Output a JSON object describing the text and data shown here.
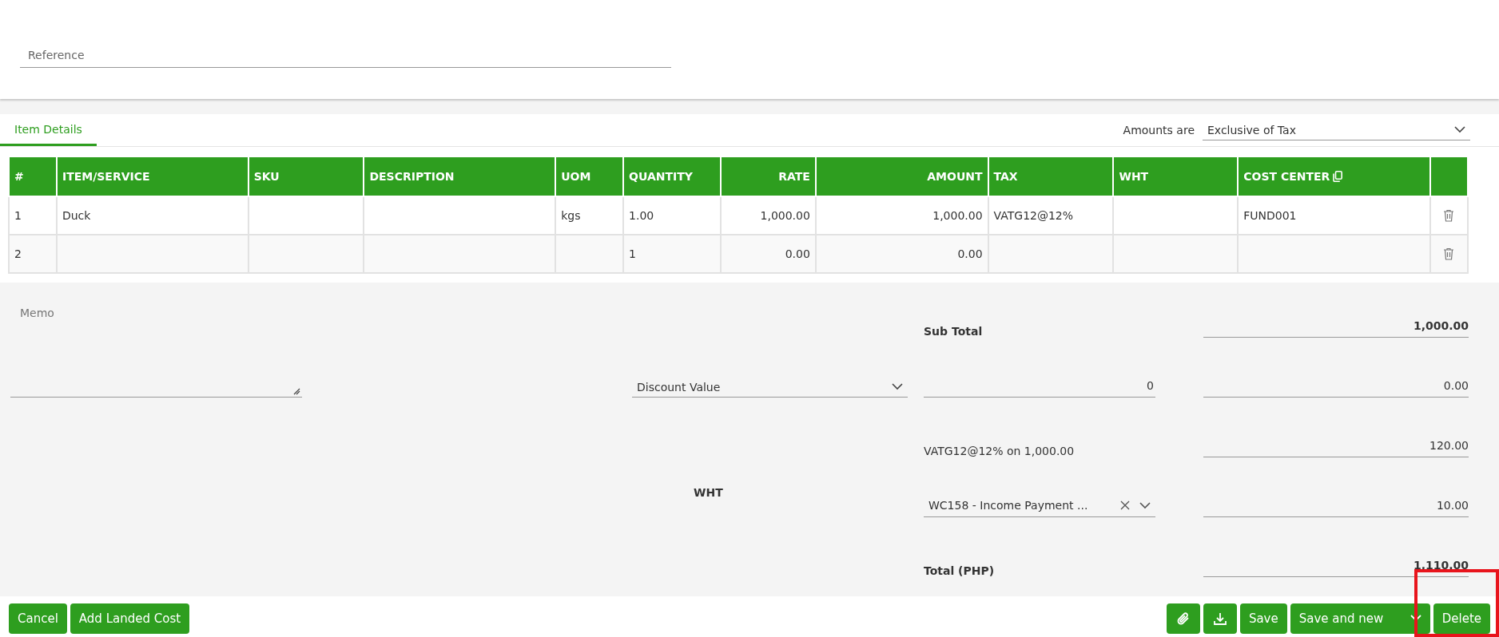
{
  "reference": {
    "placeholder": "Reference"
  },
  "tabs": [
    {
      "label": "Item Details",
      "selected": true
    }
  ],
  "amounts_are": {
    "label": "Amounts are",
    "value": "Exclusive of Tax"
  },
  "table": {
    "columns": [
      {
        "label": "#",
        "kind": "text"
      },
      {
        "label": "ITEM/SERVICE",
        "kind": "text"
      },
      {
        "label": "SKU",
        "kind": "text"
      },
      {
        "label": "DESCRIPTION",
        "kind": "text"
      },
      {
        "label": "UOM",
        "kind": "text"
      },
      {
        "label": "QUANTITY",
        "kind": "text"
      },
      {
        "label": "RATE",
        "kind": "number"
      },
      {
        "label": "AMOUNT",
        "kind": "number"
      },
      {
        "label": "TAX",
        "kind": "text"
      },
      {
        "label": "WHT",
        "kind": "text"
      },
      {
        "label": "COST CENTER",
        "kind": "copy"
      },
      {
        "kind": "delete"
      }
    ],
    "rows": [
      {
        "cells": [
          "1",
          "Duck",
          null,
          null,
          "kgs",
          "1.00",
          "1,000.00",
          "1,000.00",
          "VATG12@12%",
          null,
          "FUND001",
          null
        ]
      },
      {
        "cells": [
          "2",
          null,
          null,
          null,
          null,
          "1",
          "0.00",
          "0.00",
          null,
          null,
          null,
          null
        ]
      }
    ]
  },
  "memo": {
    "placeholder": "Memo"
  },
  "discount_type": {
    "value": "Discount Value"
  },
  "totals": {
    "sub_total": {
      "label": "Sub Total",
      "value": "1,000.00"
    },
    "discount": {
      "value": "0",
      "amount": "0.00"
    },
    "tax": {
      "label": "VATG12@12% on 1,000.00",
      "amount": "120.00"
    },
    "wht": {
      "label": "WHT",
      "value": "WC158 - Income Payment ...",
      "amount": "10.00"
    },
    "total": {
      "label": "Total (PHP)",
      "value": "1,110.00"
    }
  },
  "left_buttons": [
    {
      "label": "Cancel"
    },
    {
      "label": "Add Landed Cost"
    }
  ],
  "right_buttons": [
    {
      "kind": "attach"
    },
    {
      "kind": "download"
    },
    {
      "kind": "text",
      "label": "Save"
    },
    {
      "kind": "split",
      "label": "Save and new"
    },
    {
      "kind": "text",
      "label": "Delete"
    }
  ]
}
